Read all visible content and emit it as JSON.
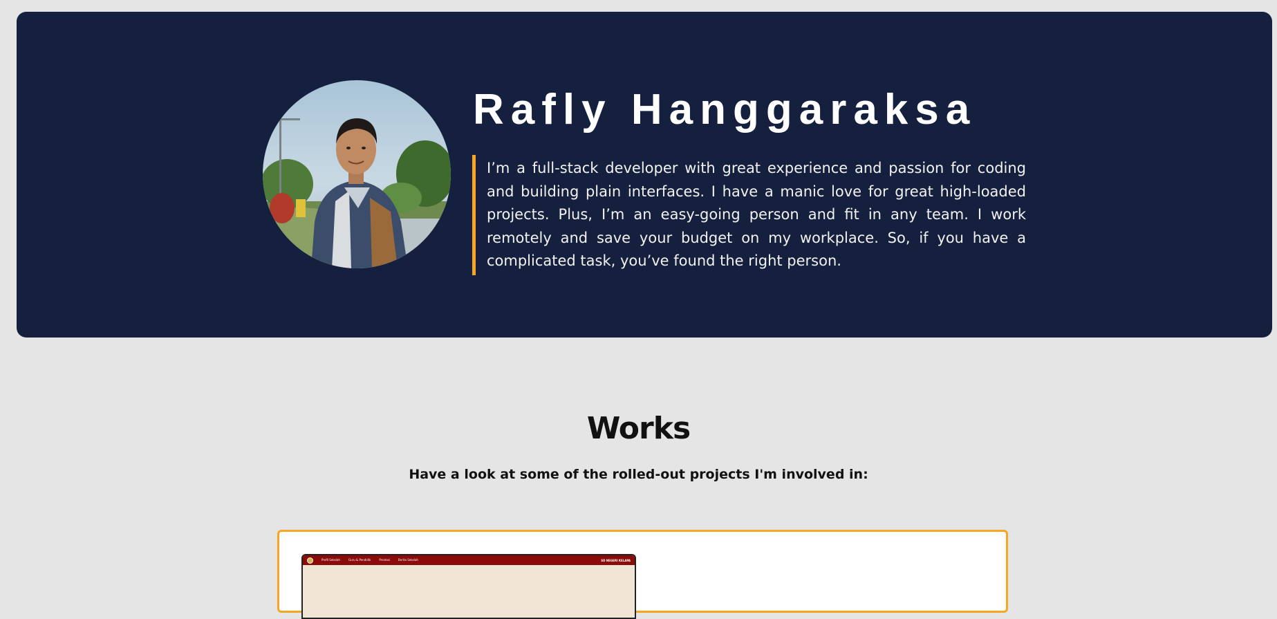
{
  "hero": {
    "name": "Rafly Hanggaraksa",
    "avatar_alt": "profile-photo",
    "bio": "I’m a full-stack developer with great experience and passion for coding and building plain interfaces. I have a manic love for great high-loaded projects. Plus, I’m an easy-going person and fit in any team. I work remotely and save your budget on my workplace. So, if you have a complicated task, you’ve found the right person."
  },
  "works": {
    "title": "Works",
    "subtitle": "Have a look at some of the rolled-out projects I'm involved in:",
    "projects": [
      {
        "thumbnail_nav": [
          "Profil Sekolah",
          "Guru & Pendidik",
          "Prestasi",
          "Berita Sekolah"
        ],
        "thumbnail_right": "SD NEGERI KELAPA"
      }
    ]
  },
  "colors": {
    "page_background": "#e5e5e5",
    "hero_background": "#14203d",
    "accent": "#f5a623",
    "thumb_nav": "#8b0a0a"
  },
  "icons": {
    "avatar": "profile-photo"
  }
}
